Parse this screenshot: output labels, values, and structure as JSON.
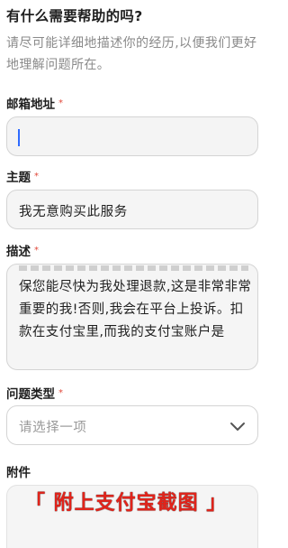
{
  "help": {
    "title": "有什么需要帮助的吗?",
    "intro": "请尽可能详细地描述你的经历,以便我们更好地理解问题所在。"
  },
  "form": {
    "email": {
      "label": "邮箱地址",
      "required_mark": "*",
      "value": ""
    },
    "subject": {
      "label": "主题",
      "required_mark": "*",
      "value": "我无意购买此服务"
    },
    "description": {
      "label": "描述",
      "required_mark": "*",
      "value": "保您能尽快为我处理退款,这是非常非常重要的我!否则,我会在平台上投诉。扣款在支付宝里,而我的支付宝账户是"
    },
    "issue_type": {
      "label": "问题类型",
      "required_mark": "*",
      "placeholder": "请选择一项",
      "icon": "chevron-down-icon"
    },
    "attachment": {
      "label": "附件",
      "banner_text": "「 附上支付宝截图 」"
    }
  },
  "colors": {
    "required": "#e0483a",
    "caret": "#2f6bff",
    "banner": "#e2231a"
  }
}
